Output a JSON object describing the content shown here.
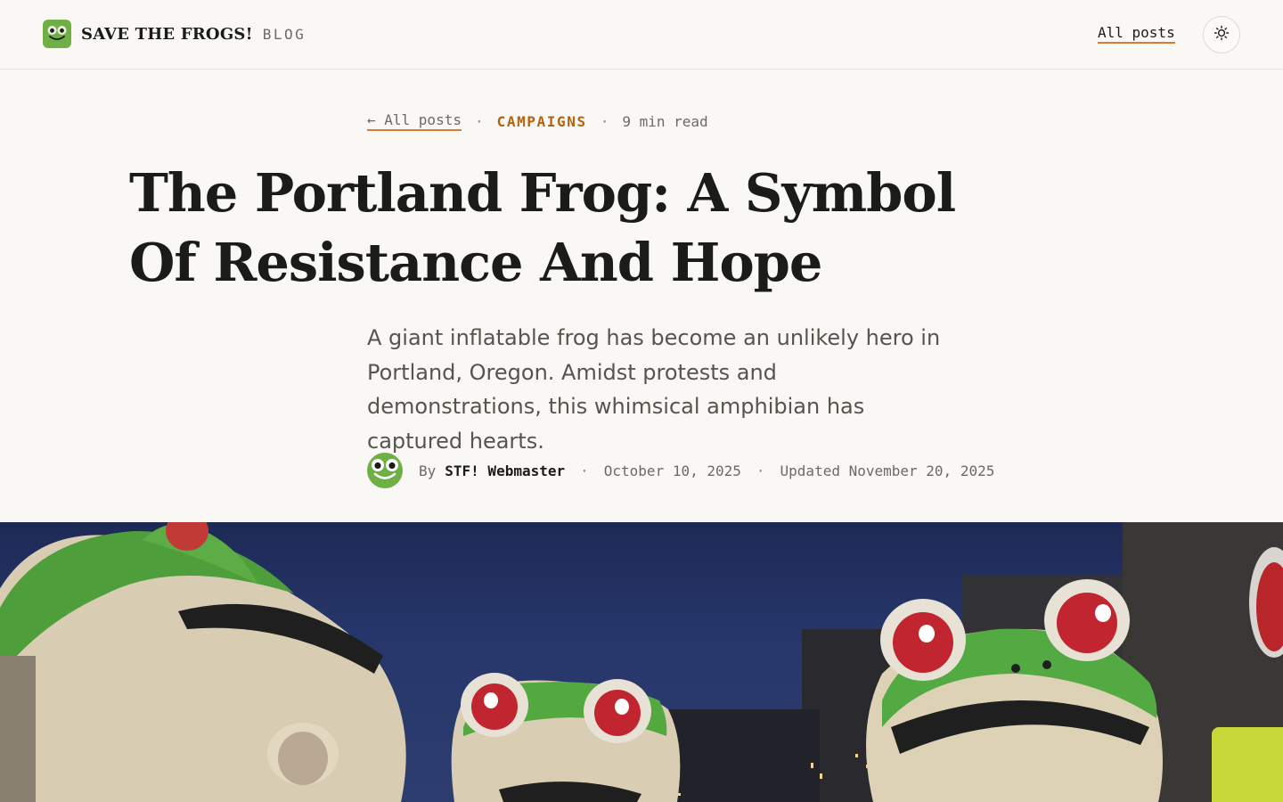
{
  "header": {
    "brand_name": "SAVE THE FROGS!",
    "brand_tag": "BLOG",
    "nav_all_posts": "All posts",
    "logo_icon": "frog-icon",
    "theme_icon": "sun-icon"
  },
  "article": {
    "back_link": "← All posts",
    "category": "CAMPAIGNS",
    "read_time": "9 min read",
    "separator": "·",
    "title_line1": "The Portland Frog: A Symbol",
    "title_line2": "Of Resistance And Hope",
    "lede": "A giant inflatable frog has become an unlikely hero in Portland, Oregon. Amidst protests and demonstrations, this whimsical amphibian has captured hearts.",
    "by_label": "By",
    "author": "STF! Webmaster",
    "date": "October 10, 2025",
    "updated": "Updated November 20, 2025",
    "avatar_icon": "frog-avatar-icon"
  },
  "hero": {
    "image_name": "inflatable-frog-costumes-photo"
  },
  "colors": {
    "accent": "#e07a2c",
    "category": "#b5620f",
    "frog_green": "#6fb046",
    "background": "#f9f8f5"
  }
}
